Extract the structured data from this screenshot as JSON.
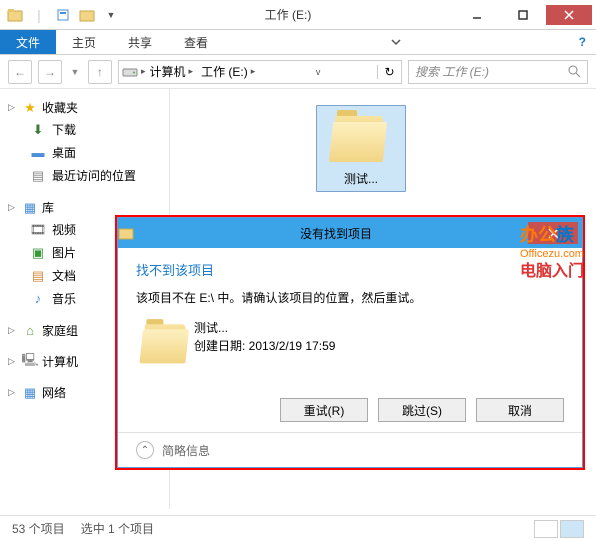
{
  "titlebar": {
    "title": "工作 (E:)"
  },
  "ribbon": {
    "file": "文件",
    "home": "主页",
    "share": "共享",
    "view": "查看"
  },
  "address": {
    "crumb1": "计算机",
    "crumb2": "工作 (E:)",
    "search_placeholder": "搜索 工作 (E:)"
  },
  "sidebar": {
    "favorites": "收藏夹",
    "downloads": "下载",
    "desktop": "桌面",
    "recent": "最近访问的位置",
    "libraries": "库",
    "videos": "视频",
    "pictures": "图片",
    "documents": "文档",
    "music": "音乐",
    "homegroup": "家庭组",
    "computer": "计算机",
    "network": "网络"
  },
  "content": {
    "folder_name": "测试..."
  },
  "dialog": {
    "title": "没有找到项目",
    "heading": "找不到该项目",
    "message": "该项目不在 E:\\ 中。请确认该项目的位置，然后重试。",
    "item_name": "测试...",
    "item_date_label": "创建日期: ",
    "item_date": "2013/2/19 17:59",
    "retry": "重试(R)",
    "skip": "跳过(S)",
    "cancel": "取消",
    "brief": "简略信息"
  },
  "watermark": {
    "l1a": "办公",
    "l1b": "族",
    "l2": "Officezu.com",
    "l3": "电脑入门"
  },
  "status": {
    "count": "53 个项目",
    "selected": "选中 1 个项目"
  }
}
